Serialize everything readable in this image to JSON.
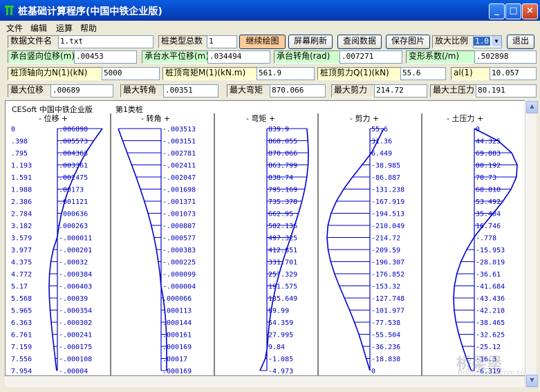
{
  "window": {
    "title": "桩基础计算程序(中国中铁企业版)",
    "buttons": {
      "minimize": "_",
      "maximize": "□",
      "close": "×"
    }
  },
  "menu": [
    "文件",
    "编辑",
    "运算",
    "帮助"
  ],
  "toolbar": {
    "file_label": "数据文件名",
    "file_value": "1.txt",
    "pile_types_label": "桩类型总数",
    "pile_types_value": "1",
    "continue_button": "继续绘图",
    "refresh_button": "屏幕刷新",
    "view_data_button": "查阅数据",
    "save_image_button": "保存图片",
    "zoom_label": "放大比例",
    "zoom_value": "1.0",
    "exit_button": "退出"
  },
  "cap": {
    "v_disp_label": "承台竖向位移(m)",
    "v_disp_value": ".00453",
    "h_disp_label": "承台水平位移(m)",
    "h_disp_value": ".034494",
    "rot_label": "承台转角(rad)",
    "rot_value": ".007271",
    "deform_label": "变形系数(/m)",
    "deform_value": ".502898"
  },
  "pile_top": {
    "n_label": "桩顶轴向力N(1)(kN)",
    "n_value": "5000",
    "m_label": "桩顶弯矩M(1)(kN.m)",
    "m_value": "561.9",
    "q_label": "桩顶剪力Q(1)(kN)",
    "q_value": "55.6",
    "al_label": "al(1)",
    "al_value": "10.057"
  },
  "maxima": {
    "disp_label": "最大位移",
    "disp_value": ".00689",
    "rot_label": "最大转角",
    "rot_value": ".00351",
    "moment_label": "最大弯矩",
    "moment_value": "870.066",
    "shear_label": "最大剪力",
    "shear_value": "214.72",
    "soil_label": "最大土压力",
    "soil_value": "80.191"
  },
  "plot": {
    "header_left": "CESoft 中国中铁企业版",
    "header_right": "第1类桩",
    "columns": {
      "displacement": "-  位移  +",
      "rotation": "-  转角  +",
      "moment": "-  弯矩  +",
      "shear": "-  剪力  +",
      "soil": "-  土压力 +"
    },
    "depths": [
      "0",
      ".398",
      ".795",
      "1.193",
      "1.591",
      "1.988",
      "2.386",
      "2.784",
      "3.182",
      "3.579",
      "3.977",
      "4.375",
      "4.772",
      "5.17",
      "5.568",
      "5.965",
      "6.363",
      "6.761",
      "7.159",
      "7.556",
      "7.954"
    ],
    "displacement": [
      ".006898",
      ".005573",
      ".004363",
      ".003361",
      ".002475",
      ".00173",
      ".001121",
      ".000636",
      ".000263",
      "-.000011",
      "-.000201",
      "-.00032",
      "-.000384",
      "-.000403",
      "-.00039",
      "-.000354",
      "-.000302",
      "-.000241",
      "-.000175",
      "-.000108",
      "-.00004"
    ],
    "displacement_num": [
      0.006898,
      0.005573,
      0.004363,
      0.003361,
      0.002475,
      0.00173,
      0.001121,
      0.000636,
      0.000263,
      -1.1e-05,
      -0.000201,
      -0.00032,
      -0.000384,
      -0.000403,
      -0.00039,
      -0.000354,
      -0.000302,
      -0.000241,
      -0.000175,
      -0.000108,
      -4e-05
    ],
    "rotation": [
      "-.003513",
      "-.003151",
      "-.002781",
      "-.002411",
      "-.002047",
      "-.001698",
      "-.001371",
      "-.001073",
      "-.000807",
      "-.000577",
      "-.000383",
      "-.000225",
      "-.000099",
      "-.000004",
      ".000066",
      ".000113",
      ".000144",
      ".000161",
      ".000169",
      ".00017",
      ".000169"
    ],
    "rotation_num": [
      -0.003513,
      -0.003151,
      -0.002781,
      -0.002411,
      -0.002047,
      -0.001698,
      -0.001371,
      -0.001073,
      -0.000807,
      -0.000577,
      -0.000383,
      -0.000225,
      -9.9e-05,
      -4e-06,
      6.6e-05,
      0.000113,
      0.000144,
      0.000161,
      0.000169,
      0.00017,
      0.000169
    ],
    "moment": [
      "839.9",
      "860.055",
      "870.066",
      "863.799",
      "838.74",
      "795.169",
      "735.378",
      "662.95",
      "582.136",
      "497.325",
      "412.851",
      "331.701",
      "257.329",
      "191.575",
      "135.649",
      "89.99",
      "54.359",
      "27.995",
      "9.84",
      "-1.085",
      "-4.973"
    ],
    "moment_num": [
      839.9,
      860.055,
      870.066,
      863.799,
      838.74,
      795.169,
      735.378,
      662.95,
      582.136,
      497.325,
      412.851,
      331.701,
      257.329,
      191.575,
      135.649,
      89.99,
      54.359,
      27.995,
      9.84,
      -1.085,
      -4.973
    ],
    "shear": [
      "55.6",
      "31.36",
      "6.449",
      "-38.985",
      "-86.887",
      "-131.238",
      "-167.919",
      "-194.513",
      "-210.049",
      "-214.72",
      "-209.59",
      "-196.307",
      "-176.852",
      "-153.32",
      "-127.748",
      "-101.977",
      "-77.538",
      "-55.504",
      "-36.236",
      "-18.838",
      "0"
    ],
    "shear_num": [
      55.6,
      31.36,
      6.449,
      -38.985,
      -86.887,
      -131.238,
      -167.919,
      -194.513,
      -210.049,
      -214.72,
      -209.59,
      -196.307,
      -176.852,
      -153.32,
      -127.748,
      -101.977,
      -77.538,
      -55.504,
      -36.236,
      -18.838,
      0
    ],
    "soil": [
      "0",
      "44.325",
      "69.883",
      "80.192",
      "78.73",
      "68.818",
      "53.492",
      "35.404",
      "16.746",
      "-.778",
      "-15.953",
      "-28.019",
      "-36.61",
      "-41.684",
      "-43.436",
      "-42.218",
      "-38.465",
      "-32.625",
      "-25.12",
      "-16.3",
      "-6.319"
    ],
    "soil_num": [
      0,
      44.325,
      69.883,
      80.192,
      78.73,
      68.818,
      53.492,
      35.404,
      16.746,
      -0.778,
      -15.953,
      -28.019,
      -36.61,
      -41.684,
      -43.436,
      -42.218,
      -38.465,
      -32.625,
      -25.12,
      -16.3,
      -6.319
    ]
  },
  "watermark": {
    "cn": "桥梁堡",
    "en": "Bridgehead.com.cn"
  },
  "colors": {
    "curve": "#0000cc",
    "number": "#0000c0",
    "titlebar": "#0a5fe0",
    "green_label": "#ccffcc",
    "yellow_label": "#ffffcc"
  }
}
